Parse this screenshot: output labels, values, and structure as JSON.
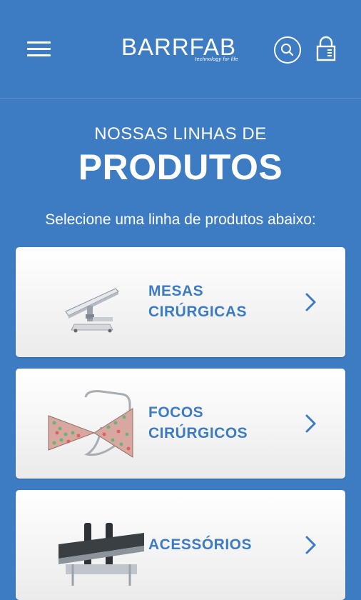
{
  "header": {
    "logo_text": "BARRFAB",
    "logo_tagline": "technology for life",
    "menu_icon": "hamburger-menu-icon",
    "search_icon": "search-icon",
    "lock_icon": "lock-icon"
  },
  "main": {
    "title_small": "NOSSAS LINHAS DE",
    "title_big": "PRODUTOS",
    "subtitle": "Selecione uma linha de produtos abaixo:"
  },
  "product_lines": [
    {
      "label": "MESAS\nCIRÚRGICAS",
      "icon": "surgical-table-image"
    },
    {
      "label": "FOCOS\nCIRÚRGICOS",
      "icon": "surgical-light-image"
    },
    {
      "label": "ACESSÓRIOS",
      "icon": "accessories-image"
    }
  ],
  "colors": {
    "brand_blue": "#3d7cc2",
    "card_bg": "#ffffff",
    "text_white": "#ffffff"
  }
}
